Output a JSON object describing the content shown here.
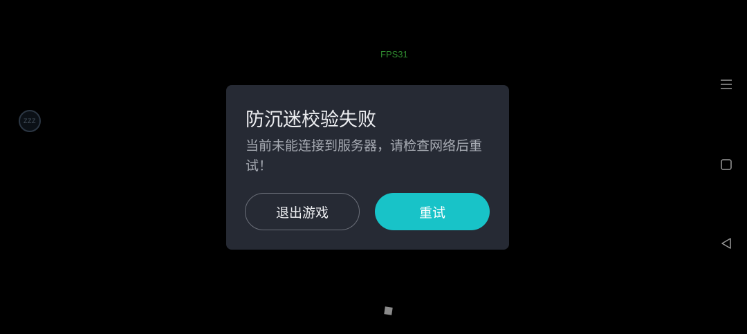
{
  "overlay": {
    "fps_text": "FPS31",
    "float_ball_text": "ZZZ"
  },
  "dialog": {
    "title": "防沉迷校验失败",
    "message": "当前未能连接到服务器，请检查网络后重试！",
    "exit_label": "退出游戏",
    "retry_label": "重试"
  },
  "nav": {
    "menu_icon": "menu-icon",
    "home_icon": "home-square-icon",
    "back_icon": "back-triangle-icon"
  },
  "colors": {
    "background": "#000000",
    "dialog_bg": "#262a34",
    "accent": "#18c3c8",
    "fps_green": "#2f8a2f"
  }
}
